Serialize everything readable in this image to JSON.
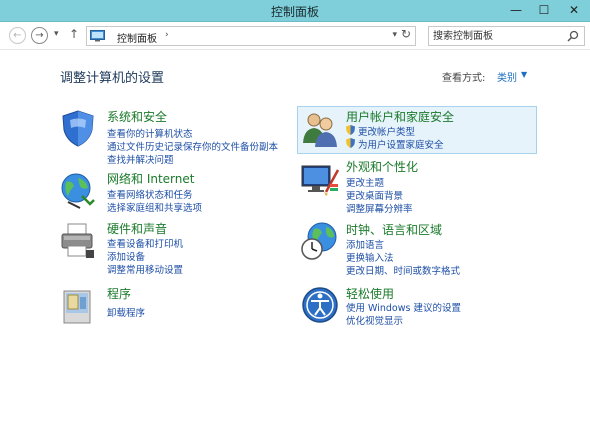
{
  "window": {
    "title": "控制面板",
    "minimize_glyph": "—",
    "maximize_glyph": "☐",
    "close_glyph": "✕"
  },
  "nav": {
    "back_glyph": "←",
    "forward_glyph": "→",
    "recent_glyph": "▾",
    "up_glyph": "↑",
    "address": {
      "icon": "control-panel-icon",
      "crumb": "控制面板",
      "separator": "›",
      "dropdown_glyph": "▾"
    },
    "refresh_glyph": "↻",
    "search": {
      "placeholder": "搜索控制面板",
      "icon": "search-icon"
    }
  },
  "main": {
    "heading": "调整计算机的设置",
    "view_by": {
      "label": "查看方式:",
      "value": "类别",
      "arrow": "▼"
    },
    "left_categories": [
      {
        "title": "系统和安全",
        "icon": "shield-security-icon",
        "links": [
          "查看你的计算机状态",
          "通过文件历史记录保存你的文件备份副本",
          "查找并解决问题"
        ]
      },
      {
        "title": "网络和 Internet",
        "icon": "network-globe-icon",
        "links": [
          "查看网络状态和任务",
          "选择家庭组和共享选项"
        ]
      },
      {
        "title": "硬件和声音",
        "icon": "printer-icon",
        "links": [
          "查看设备和打印机",
          "添加设备",
          "调整常用移动设置"
        ]
      },
      {
        "title": "程序",
        "icon": "programs-box-icon",
        "links": [
          "卸载程序"
        ]
      }
    ],
    "right_categories": [
      {
        "title": "用户帐户和家庭安全",
        "icon": "users-icon",
        "links": [
          "更改帐户类型",
          "为用户设置家庭安全"
        ]
      },
      {
        "title": "外观和个性化",
        "icon": "monitor-paint-icon",
        "links": [
          "更改主题",
          "更改桌面背景",
          "调整屏幕分辨率"
        ]
      },
      {
        "title": "时钟、语言和区域",
        "icon": "clock-globe-icon",
        "links": [
          "添加语言",
          "更换输入法",
          "更改日期、时间或数字格式"
        ]
      },
      {
        "title": "轻松使用",
        "icon": "ease-of-access-icon",
        "links": [
          "使用 Windows 建议的设置",
          "优化视觉显示"
        ]
      }
    ]
  },
  "colors": {
    "titlebar": "#7ecfd9",
    "category_title": "#1a7a2a",
    "link": "#1e4fa6",
    "heading": "#1e395b",
    "highlight_bg": "#e7f3fb",
    "highlight_border": "#a8d3ef"
  }
}
